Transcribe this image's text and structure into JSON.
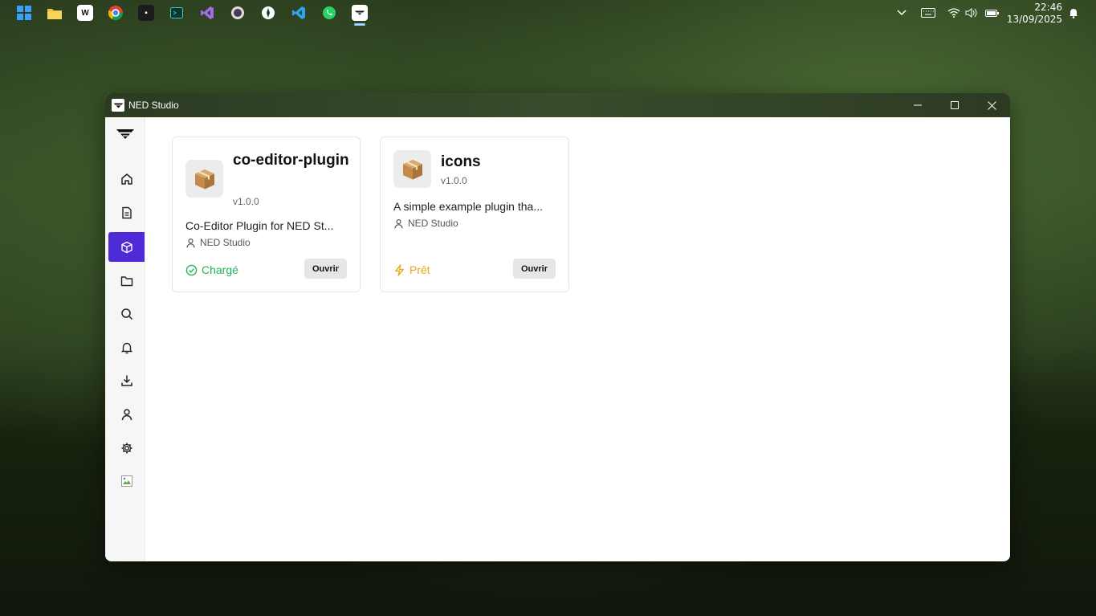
{
  "window": {
    "title": "NED Studio"
  },
  "clock": {
    "time": "22:46",
    "date": "13/09/2025"
  },
  "sidebar": {
    "active": "plugins",
    "items": [
      "home",
      "documents",
      "plugins",
      "folders",
      "search",
      "notifications",
      "downloads",
      "profile",
      "settings",
      "broken-image"
    ]
  },
  "plugins": [
    {
      "name": "co-editor-plugin",
      "version": "v1.0.0",
      "description": "Co-Editor Plugin for NED St...",
      "author": "NED Studio",
      "status": "Chargé",
      "status_color": "#22b45a",
      "open_label": "Ouvrir"
    },
    {
      "name": "icons",
      "version": "v1.0.0",
      "description": "A simple example plugin tha...",
      "author": "NED Studio",
      "status": "Prêt",
      "status_color": "#e6a817",
      "open_label": "Ouvrir"
    }
  ],
  "colors": {
    "accent": "#4f2bd8"
  }
}
